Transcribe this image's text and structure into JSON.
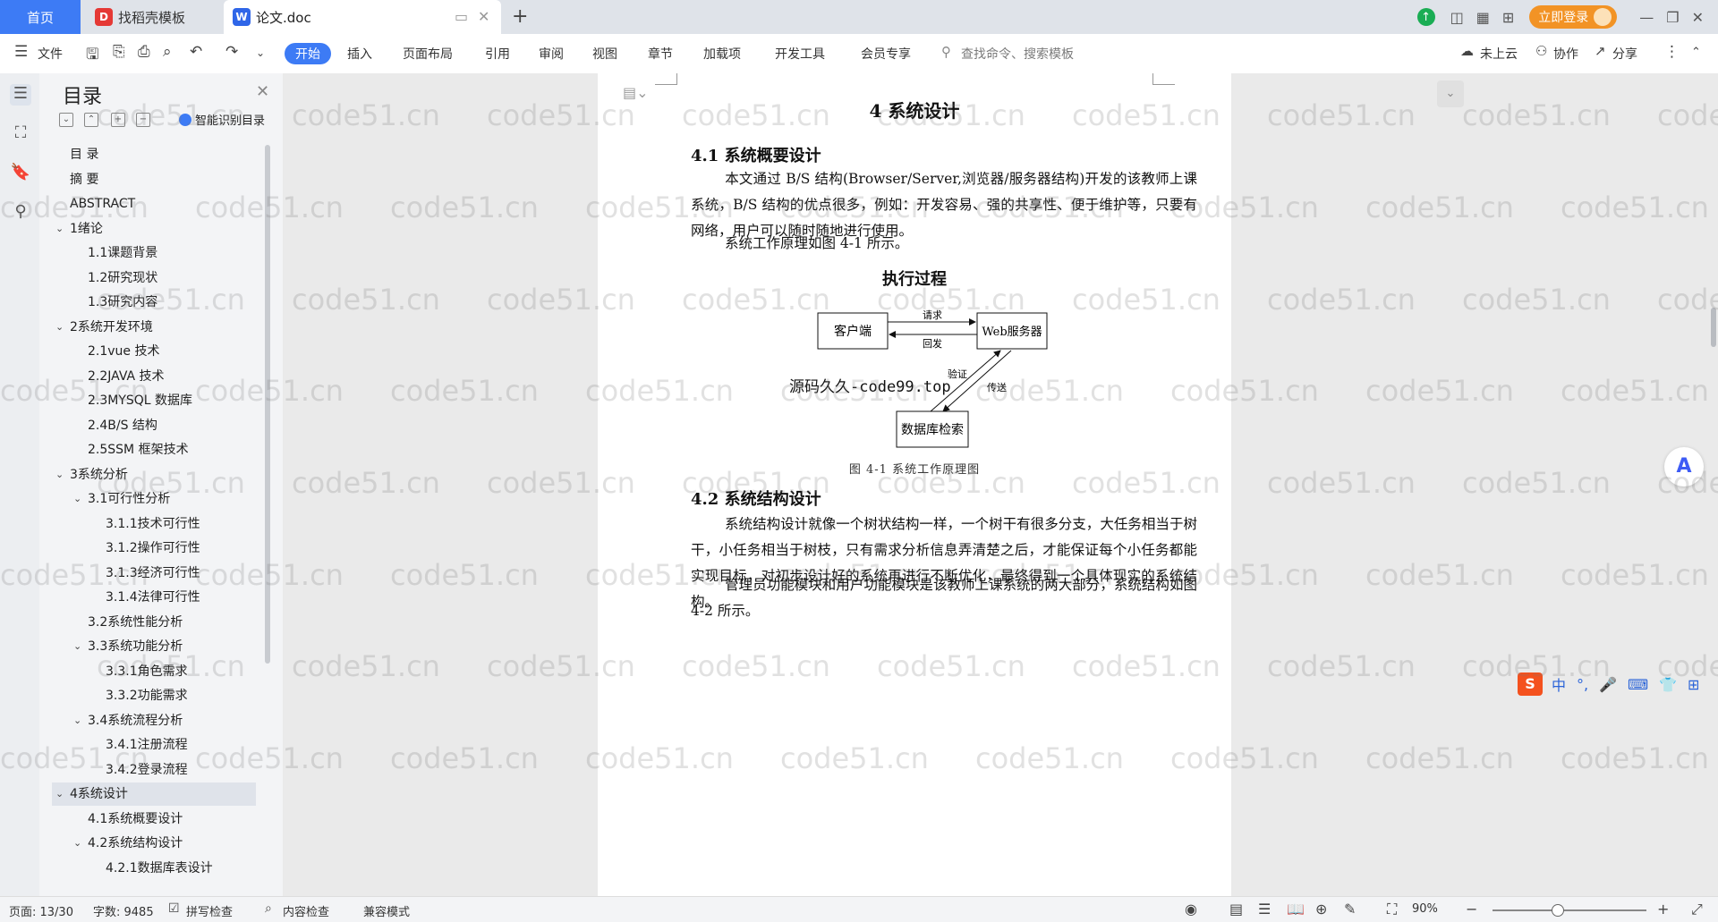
{
  "tabs": {
    "home": "首页",
    "template": "找稻壳模板",
    "doc": "论文.doc",
    "add": "+"
  },
  "titlebar": {
    "login": "立即登录"
  },
  "ribbon": {
    "file": "文件",
    "menus": [
      "开始",
      "插入",
      "页面布局",
      "引用",
      "审阅",
      "视图",
      "章节",
      "加载项",
      "开发工具",
      "会员专享"
    ],
    "search": "查找命令、搜索模板",
    "cloud": "未上云",
    "collab": "协作",
    "share": "分享"
  },
  "nav": {
    "title": "目录",
    "smart": "智能识别目录",
    "items": [
      {
        "label": "目 录",
        "level": 1
      },
      {
        "label": "摘 要",
        "level": 1
      },
      {
        "label": "ABSTRACT",
        "level": 1
      },
      {
        "label": "1绪论",
        "level": 1
      },
      {
        "label": "1.1课题背景",
        "level": 2
      },
      {
        "label": "1.2研究现状",
        "level": 2
      },
      {
        "label": "1.3研究内容",
        "level": 2
      },
      {
        "label": "2系统开发环境",
        "level": 1
      },
      {
        "label": "2.1vue 技术",
        "level": 2
      },
      {
        "label": "2.2JAVA 技术",
        "level": 2
      },
      {
        "label": "2.3MYSQL 数据库",
        "level": 2
      },
      {
        "label": "2.4B/S 结构",
        "level": 2
      },
      {
        "label": "2.5SSM 框架技术",
        "level": 2
      },
      {
        "label": "3系统分析",
        "level": 1
      },
      {
        "label": "3.1可行性分析",
        "level": 2
      },
      {
        "label": "3.1.1技术可行性",
        "level": 3
      },
      {
        "label": "3.1.2操作可行性",
        "level": 3
      },
      {
        "label": "3.1.3经济可行性",
        "level": 3
      },
      {
        "label": "3.1.4法律可行性",
        "level": 3
      },
      {
        "label": "3.2系统性能分析",
        "level": 2
      },
      {
        "label": "3.3系统功能分析",
        "level": 2
      },
      {
        "label": "3.3.1角色需求",
        "level": 3
      },
      {
        "label": "3.3.2功能需求",
        "level": 3
      },
      {
        "label": "3.4系统流程分析",
        "level": 2
      },
      {
        "label": "3.4.1注册流程",
        "level": 3
      },
      {
        "label": "3.4.2登录流程",
        "level": 3
      },
      {
        "label": "4系统设计",
        "level": 1
      },
      {
        "label": "4.1系统概要设计",
        "level": 2
      },
      {
        "label": "4.2系统结构设计",
        "level": 2
      },
      {
        "label": "4.2.1数据库表设计",
        "level": 3
      }
    ],
    "selected": "4系统设计"
  },
  "document": {
    "chapter": "4  系统设计",
    "sec1_title": "4.1  系统概要设计",
    "sec1_p1": "本文通过 B/S 结构(Browser/Server,浏览器/服务器结构)开发的该教师上课系统，B/S 结构的优点很多，例如：开发容易、强的共享性、便于维护等，只要有网络，用户可以随时随地进行使用。",
    "sec1_p2": "系统工作原理如图 4-1 所示。",
    "figure": {
      "title": "执行过程",
      "client": "客户端",
      "server": "Web服务器",
      "db": "数据库检索",
      "request": "请求",
      "reply": "回发",
      "verify": "验证",
      "transfer": "传送",
      "source": "源码久久-code99.top",
      "caption": "图 4-1  系统工作原理图"
    },
    "sec2_title": "4.2  系统结构设计",
    "sec2_p1": "系统结构设计就像一个树状结构一样，一个树干有很多分支，大任务相当于树干，小任务相当于树枝，只有需求分析信息弄清楚之后，才能保证每个小任务都能实现目标，对初步设计好的系统再进行不断优化，最终得到一个具体现实的系统结构。",
    "sec2_p2": "管理员功能模块和用户功能模块是该教师上课系统的两大部分，系统结构如图 4-2 所示。"
  },
  "watermark": "code51.cn",
  "ime": {
    "lang": "中"
  },
  "status": {
    "page": "页面: 13/30",
    "words": "字数: 9485",
    "spell": "拼写检查",
    "content": "内容检查",
    "compat": "兼容模式",
    "zoom": "90%",
    "zoom_level": 0.42
  },
  "colors": {
    "accent": "#3d7bf5",
    "login": "#f29325"
  }
}
